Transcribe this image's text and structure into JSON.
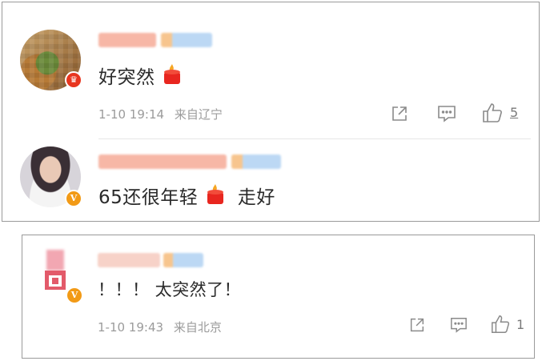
{
  "comments": [
    {
      "text": "好突然",
      "time": "1-10 19:14",
      "location": "来自辽宁",
      "likes": "5",
      "badge": "♛"
    },
    {
      "text_before": "65还很年轻",
      "text_after": "走好",
      "badge": "V"
    },
    {
      "text": "！！！ 太突然了！",
      "time": "1-10 19:43",
      "location": "来自北京",
      "likes": "1",
      "badge": "V"
    }
  ],
  "icons": [
    "share-icon",
    "comment-icon",
    "like-icon",
    "candle-icon"
  ],
  "colors": {
    "badge_red": "#e8361f",
    "badge_orange": "#f29a16",
    "meta_gray": "#9b9b9b",
    "text": "#2a2a2a"
  }
}
